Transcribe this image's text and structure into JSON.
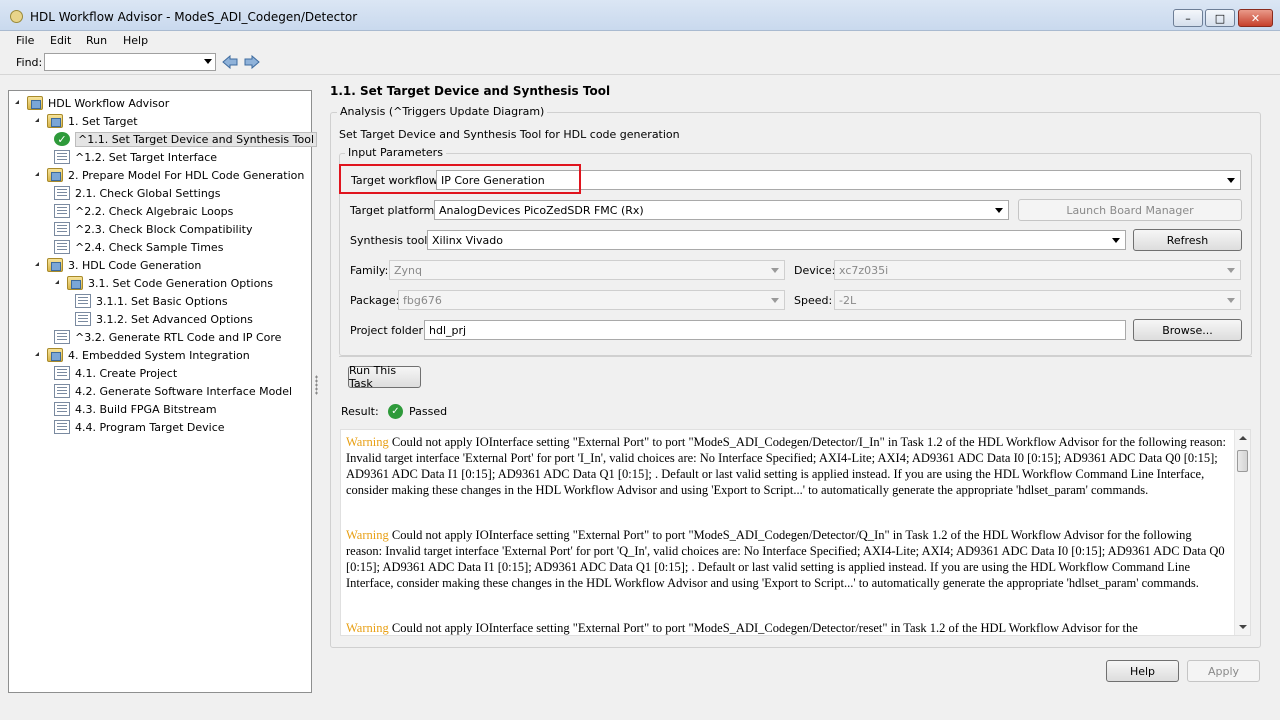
{
  "window": {
    "title": "HDL Workflow Advisor - ModeS_ADI_Codegen/Detector"
  },
  "menu": [
    "File",
    "Edit",
    "Run",
    "Help"
  ],
  "find": {
    "label": "Find:",
    "value": ""
  },
  "tree": [
    {
      "label": "HDL Workflow Advisor",
      "type": "folder",
      "level": 0
    },
    {
      "label": "1. Set Target",
      "type": "folder",
      "level": 1
    },
    {
      "label": "^1.1. Set Target Device and Synthesis Tool",
      "type": "check",
      "level": 2,
      "selected": true
    },
    {
      "label": "^1.2. Set Target Interface",
      "type": "task",
      "level": 2
    },
    {
      "label": "2. Prepare Model For HDL Code Generation",
      "type": "folder",
      "level": 1
    },
    {
      "label": "2.1. Check Global Settings",
      "type": "task",
      "level": 2
    },
    {
      "label": "^2.2. Check Algebraic Loops",
      "type": "task",
      "level": 2
    },
    {
      "label": "^2.3. Check Block Compatibility",
      "type": "task",
      "level": 2
    },
    {
      "label": "^2.4. Check Sample Times",
      "type": "task",
      "level": 2
    },
    {
      "label": "3. HDL Code Generation",
      "type": "folder",
      "level": 1
    },
    {
      "label": "3.1. Set Code Generation Options",
      "type": "folder",
      "level": 2
    },
    {
      "label": "3.1.1. Set Basic Options",
      "type": "task",
      "level": 3
    },
    {
      "label": "3.1.2. Set Advanced Options",
      "type": "task",
      "level": 3
    },
    {
      "label": "^3.2. Generate RTL Code and IP Core",
      "type": "task",
      "level": 2
    },
    {
      "label": "4. Embedded System Integration",
      "type": "folder",
      "level": 1
    },
    {
      "label": "4.1. Create Project",
      "type": "task",
      "level": 2
    },
    {
      "label": "4.2. Generate Software Interface Model",
      "type": "task",
      "level": 2
    },
    {
      "label": "4.3. Build FPGA Bitstream",
      "type": "task",
      "level": 2
    },
    {
      "label": "4.4. Program Target Device",
      "type": "task",
      "level": 2
    }
  ],
  "task": {
    "heading": "1.1. Set Target Device and Synthesis Tool",
    "analysis_legend": "Analysis (^Triggers Update Diagram)",
    "description": "Set Target Device and Synthesis Tool for HDL code generation",
    "input_legend": "Input Parameters",
    "fields": {
      "workflow": {
        "label": "Target workflow:",
        "value": "IP Core Generation"
      },
      "platform": {
        "label": "Target platform:",
        "value": "AnalogDevices PicoZedSDR FMC (Rx)"
      },
      "tool": {
        "label": "Synthesis tool:",
        "value": "Xilinx Vivado"
      },
      "family": {
        "label": "Family:",
        "value": "Zynq"
      },
      "device": {
        "label": "Device:",
        "value": "xc7z035i"
      },
      "package": {
        "label": "Package:",
        "value": "fbg676"
      },
      "speed": {
        "label": "Speed:",
        "value": "-2L"
      },
      "folder": {
        "label": "Project folder:",
        "value": "hdl_prj"
      }
    },
    "buttons": {
      "launch": "Launch Board Manager",
      "refresh": "Refresh",
      "browse": "Browse...",
      "run": "Run This Task",
      "help": "Help",
      "apply": "Apply"
    },
    "result": {
      "label": "Result:",
      "value": "Passed"
    }
  },
  "messages": [
    {
      "tag": "Warning",
      "text": " Could not apply IOInterface setting \"External Port\" to port \"ModeS_ADI_Codegen/Detector/I_In\" in Task 1.2 of the HDL Workflow Advisor for the following reason: Invalid target interface 'External Port' for port 'I_In', valid choices are: No Interface Specified; AXI4-Lite; AXI4; AD9361 ADC Data I0 [0:15]; AD9361 ADC Data Q0 [0:15]; AD9361 ADC Data I1 [0:15]; AD9361 ADC Data Q1 [0:15]; . Default or last valid setting is applied instead. If you are using the HDL Workflow Command Line Interface, consider making these changes in the HDL Workflow Advisor and using 'Export to Script...' to automatically generate the appropriate 'hdlset_param' commands."
    },
    {
      "tag": "Warning",
      "text": " Could not apply IOInterface setting \"External Port\" to port \"ModeS_ADI_Codegen/Detector/Q_In\" in Task 1.2 of the HDL Workflow Advisor for the following reason: Invalid target interface 'External Port' for port 'Q_In', valid choices are: No Interface Specified; AXI4-Lite; AXI4; AD9361 ADC Data I0 [0:15]; AD9361 ADC Data Q0 [0:15]; AD9361 ADC Data I1 [0:15]; AD9361 ADC Data Q1 [0:15]; . Default or last valid setting is applied instead. If you are using the HDL Workflow Command Line Interface, consider making these changes in the HDL Workflow Advisor and using 'Export to Script...' to automatically generate the appropriate 'hdlset_param' commands."
    },
    {
      "tag": "Warning",
      "text": " Could not apply IOInterface setting \"External Port\" to port \"ModeS_ADI_Codegen/Detector/reset\" in Task 1.2 of the HDL Workflow Advisor for the"
    }
  ]
}
